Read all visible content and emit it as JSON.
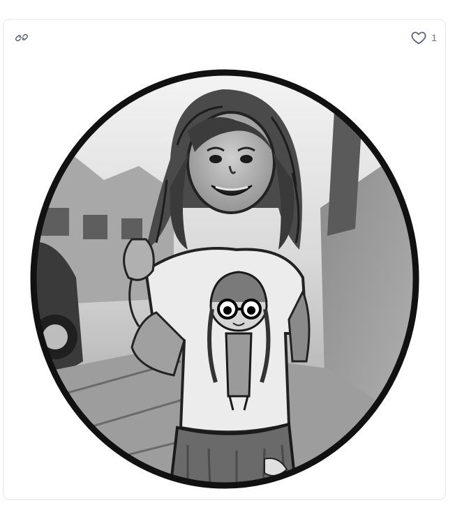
{
  "card": {
    "likes": "1",
    "icons": {
      "link": "link-icon",
      "like": "heart-outline-icon"
    },
    "image": {
      "subject": "child-portrait",
      "style": "black-and-white sketch filter",
      "frame": "circle"
    }
  },
  "colors": {
    "icon": "#5b6472",
    "border": "#e6e8ec",
    "frame": "#111111"
  }
}
